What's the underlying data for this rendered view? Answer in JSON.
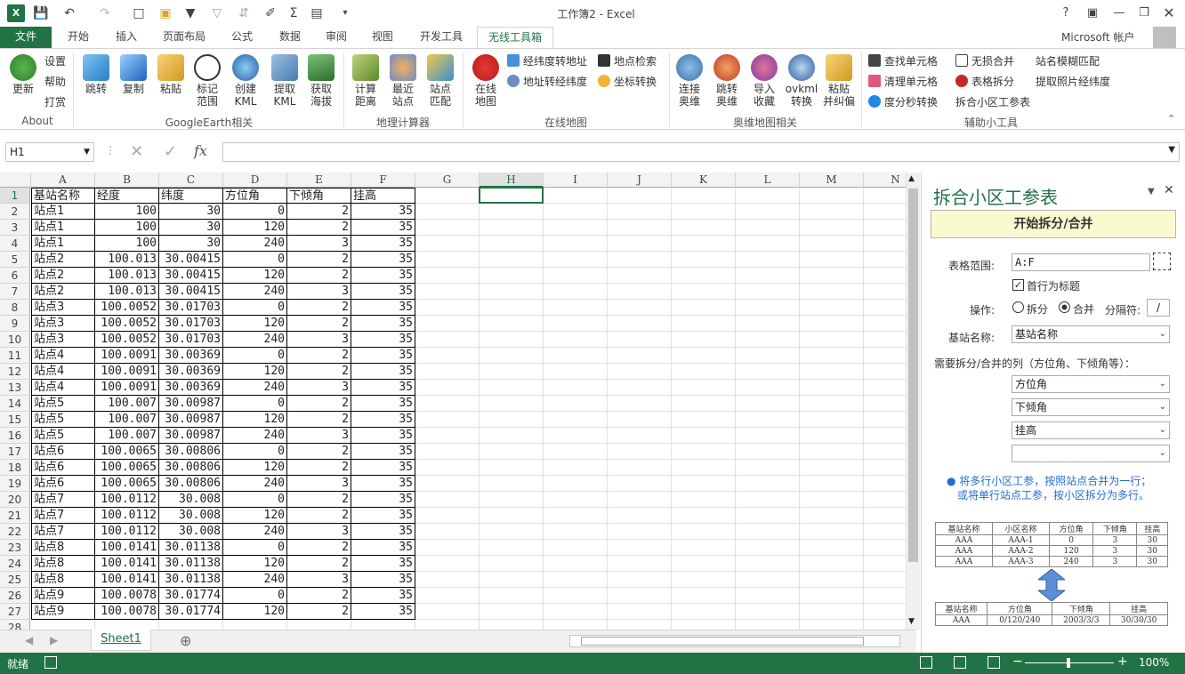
{
  "window": {
    "title": "工作簿2 - Excel",
    "account": "Microsoft 帐户"
  },
  "tabs": [
    {
      "label": "文件"
    },
    {
      "label": "开始"
    },
    {
      "label": "插入"
    },
    {
      "label": "页面布局"
    },
    {
      "label": "公式"
    },
    {
      "label": "数据"
    },
    {
      "label": "审阅"
    },
    {
      "label": "视图"
    },
    {
      "label": "开发工具"
    },
    {
      "label": "无线工具箱"
    }
  ],
  "ribbon": {
    "about": {
      "update": "更新",
      "settings": "设置",
      "help": "帮助",
      "reward": "打赏",
      "label": "About"
    },
    "google_earth": {
      "jump": "跳转",
      "copy": "复制",
      "paste": "粘贴",
      "mark_range": "标记\n范围",
      "create_kml": "创建\nKML",
      "extract_kml": "提取\nKML",
      "get_altitude": "获取\n海拔",
      "label": "GoogleEarth相关"
    },
    "geo_calc": {
      "calc_distance": "计算\n距离",
      "nearest_site": "最近\n站点",
      "site_match": "站点\n匹配",
      "label": "地理计算器"
    },
    "online_map": {
      "online_map": "在线\n地图",
      "latlng_to_addr": "经纬度转地址",
      "addr_to_latlng": "地址转经纬度",
      "poi_search": "地点检索",
      "coord_convert": "坐标转换",
      "label": "在线地图"
    },
    "ovi_map": {
      "connect": "连接\n奥维",
      "jump": "跳转\n奥维",
      "import_fav": "导入\n收藏",
      "ovkml": "ovkml\n转换",
      "paste_offset": "粘贴\n并纠偏",
      "label": "奥维地图相关"
    },
    "tools": {
      "find_cell": "查找单元格",
      "lossless_merge": "无损合并",
      "clean_cell": "清理单元格",
      "table_split": "表格拆分",
      "dms_convert": "度分秒转换",
      "split_merge": "拆合小区工参表",
      "fuzzy_match": "站名模糊匹配",
      "photo_latlng": "提取照片经纬度",
      "label": "辅助小工具"
    }
  },
  "formula_bar": {
    "name_box": "H1",
    "fx": "fx",
    "value": ""
  },
  "columns": [
    "A",
    "B",
    "C",
    "D",
    "E",
    "F",
    "G",
    "H",
    "I",
    "J",
    "K",
    "L",
    "M",
    "N"
  ],
  "rows": [
    [
      "基站名称",
      "经度",
      "纬度",
      "方位角",
      "下倾角",
      "挂高"
    ],
    [
      "站点1",
      "100",
      "30",
      "0",
      "2",
      "35"
    ],
    [
      "站点1",
      "100",
      "30",
      "120",
      "2",
      "35"
    ],
    [
      "站点1",
      "100",
      "30",
      "240",
      "3",
      "35"
    ],
    [
      "站点2",
      "100.013",
      "30.00415",
      "0",
      "2",
      "35"
    ],
    [
      "站点2",
      "100.013",
      "30.00415",
      "120",
      "2",
      "35"
    ],
    [
      "站点2",
      "100.013",
      "30.00415",
      "240",
      "3",
      "35"
    ],
    [
      "站点3",
      "100.0052",
      "30.01703",
      "0",
      "2",
      "35"
    ],
    [
      "站点3",
      "100.0052",
      "30.01703",
      "120",
      "2",
      "35"
    ],
    [
      "站点3",
      "100.0052",
      "30.01703",
      "240",
      "3",
      "35"
    ],
    [
      "站点4",
      "100.0091",
      "30.00369",
      "0",
      "2",
      "35"
    ],
    [
      "站点4",
      "100.0091",
      "30.00369",
      "120",
      "2",
      "35"
    ],
    [
      "站点4",
      "100.0091",
      "30.00369",
      "240",
      "3",
      "35"
    ],
    [
      "站点5",
      "100.007",
      "30.00987",
      "0",
      "2",
      "35"
    ],
    [
      "站点5",
      "100.007",
      "30.00987",
      "120",
      "2",
      "35"
    ],
    [
      "站点5",
      "100.007",
      "30.00987",
      "240",
      "3",
      "35"
    ],
    [
      "站点6",
      "100.0065",
      "30.00806",
      "0",
      "2",
      "35"
    ],
    [
      "站点6",
      "100.0065",
      "30.00806",
      "120",
      "2",
      "35"
    ],
    [
      "站点6",
      "100.0065",
      "30.00806",
      "240",
      "3",
      "35"
    ],
    [
      "站点7",
      "100.0112",
      "30.008",
      "0",
      "2",
      "35"
    ],
    [
      "站点7",
      "100.0112",
      "30.008",
      "120",
      "2",
      "35"
    ],
    [
      "站点7",
      "100.0112",
      "30.008",
      "240",
      "3",
      "35"
    ],
    [
      "站点8",
      "100.0141",
      "30.01138",
      "0",
      "2",
      "35"
    ],
    [
      "站点8",
      "100.0141",
      "30.01138",
      "120",
      "2",
      "35"
    ],
    [
      "站点8",
      "100.0141",
      "30.01138",
      "240",
      "3",
      "35"
    ],
    [
      "站点9",
      "100.0078",
      "30.01774",
      "0",
      "2",
      "35"
    ],
    [
      "站点9",
      "100.0078",
      "30.01774",
      "120",
      "2",
      "35"
    ]
  ],
  "sheet": {
    "tab": "Sheet1",
    "add": "⊕"
  },
  "status": {
    "ready": "就绪",
    "zoom": "100%",
    "minus": "−",
    "plus": "+"
  },
  "pane": {
    "title": "拆合小区工参表",
    "start_button": "开始拆分/合并",
    "range_label": "表格范围:",
    "range_value": "A:F",
    "header_row": "首行为标题",
    "op_label": "操作:",
    "op_split": "拆分",
    "op_merge": "合并",
    "sep_label": "分隔符:",
    "sep_value": "/",
    "site_label": "基站名称:",
    "site_value": "基站名称",
    "cols_label": "需要拆分/合并的列（方位角、下倾角等）：",
    "col1": "方位角",
    "col2": "下倾角",
    "col3": "挂高",
    "col4": "",
    "hint1": "● 将多行小区工参，按照站点合并为一行；",
    "hint2": "或将单行站点工参，按小区拆分为多行。",
    "ex_top_head": [
      "基站名称",
      "小区名称",
      "方位角",
      "下倾角",
      "挂高"
    ],
    "ex_top_rows": [
      [
        "AAA",
        "AAA-1",
        "0",
        "3",
        "30"
      ],
      [
        "AAA",
        "AAA-2",
        "120",
        "3",
        "30"
      ],
      [
        "AAA",
        "AAA-3",
        "240",
        "3",
        "30"
      ]
    ],
    "ex_bot_head": [
      "基站名称",
      "方位角",
      "下倾角",
      "挂高"
    ],
    "ex_bot_row": [
      "AAA",
      "0/120/240",
      "2003/3/3",
      "30/30/30"
    ]
  },
  "colors": {
    "excel_green": "#217346",
    "tab_green": "#217346",
    "pane_title": "#217346",
    "button_bg": "#fbf9d0",
    "hint_blue": "#1f6fd0"
  }
}
